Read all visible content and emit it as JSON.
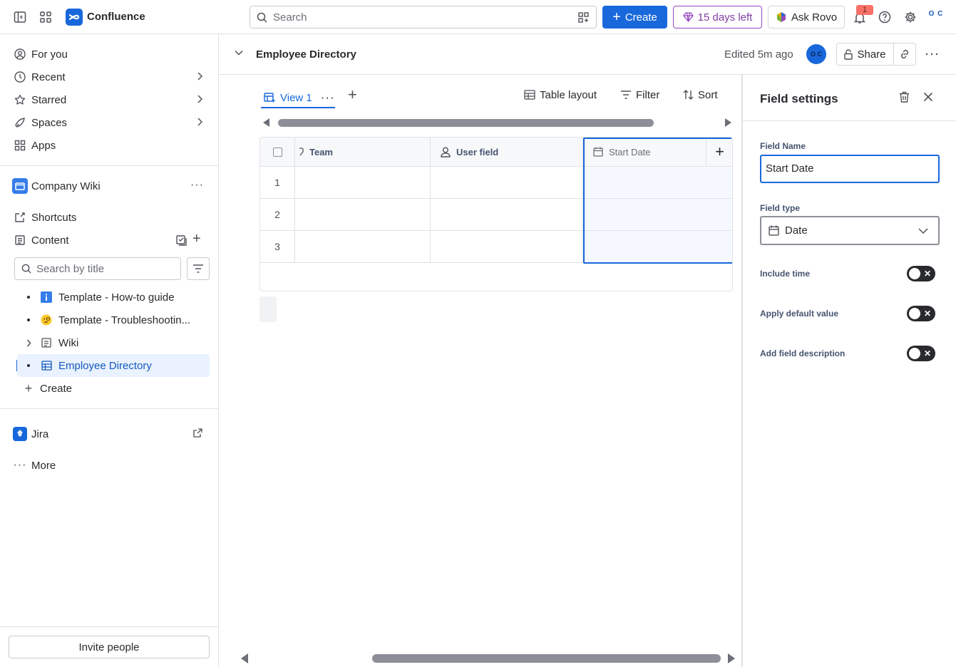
{
  "topbar": {
    "app_name": "Confluence",
    "search_placeholder": "Search",
    "create_label": "Create",
    "trial_label": "15 days left",
    "rovo_label": "Ask Rovo",
    "notification_count": "1",
    "account_initials": "O C"
  },
  "sidebar": {
    "nav": [
      {
        "label": "For you",
        "icon": "user-circle-icon"
      },
      {
        "label": "Recent",
        "icon": "clock-icon"
      },
      {
        "label": "Starred",
        "icon": "star-icon"
      },
      {
        "label": "Spaces",
        "icon": "spaces-icon"
      },
      {
        "label": "Apps",
        "icon": "apps-icon"
      }
    ],
    "space_name": "Company Wiki",
    "shortcuts_label": "Shortcuts",
    "content_label": "Content",
    "content_search_placeholder": "Search by title",
    "tree": [
      {
        "label": "Template - How-to guide",
        "icon": "info-icon"
      },
      {
        "label": "Template - Troubleshootin...",
        "icon": "emoji-icon"
      },
      {
        "label": "Wiki",
        "icon": "page-icon"
      },
      {
        "label": "Employee Directory",
        "icon": "database-icon"
      }
    ],
    "create_label": "Create",
    "jira_label": "Jira",
    "more_label": "More",
    "invite_label": "Invite people"
  },
  "page": {
    "title": "Employee Directory",
    "edited": "Edited 5m ago",
    "avatar_initials": "O C",
    "share_label": "Share"
  },
  "database": {
    "view_label": "View 1",
    "tools": {
      "layout": "Table layout",
      "filter": "Filter",
      "sort": "Sort"
    },
    "columns": [
      {
        "label": "Team",
        "icon": "tag-icon"
      },
      {
        "label": "User field",
        "icon": "person-icon"
      },
      {
        "label": "Start Date",
        "icon": "calendar-icon"
      }
    ],
    "rows": [
      "1",
      "2",
      "3"
    ]
  },
  "panel": {
    "title": "Field settings",
    "field_name_label": "Field Name",
    "field_name_value": "Start Date",
    "field_type_label": "Field type",
    "field_type_value": "Date",
    "toggles": [
      {
        "label": "Include time",
        "on": false
      },
      {
        "label": "Apply default value",
        "on": false
      },
      {
        "label": "Add field description",
        "on": false
      }
    ]
  },
  "colors": {
    "accent": "#1868db",
    "trial": "#964ac0",
    "badge": "#f87168"
  }
}
